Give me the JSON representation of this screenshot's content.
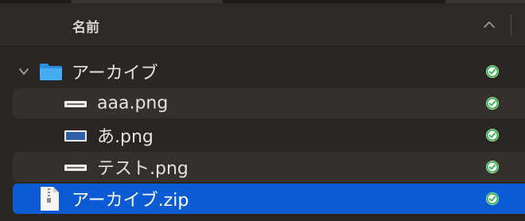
{
  "header": {
    "name_column_label": "名前"
  },
  "rows": [
    {
      "label": "アーカイブ",
      "type": "folder",
      "expanded": true,
      "sync_status": "synced"
    },
    {
      "label": "aaa.png",
      "type": "png",
      "sync_status": "synced"
    },
    {
      "label": "あ.png",
      "type": "png",
      "sync_status": "synced"
    },
    {
      "label": "テスト.png",
      "type": "png",
      "sync_status": "synced"
    },
    {
      "label": "アーカイブ.zip",
      "type": "zip",
      "selected": true,
      "sync_status": "synced"
    }
  ],
  "icons": {
    "sort": "chevron-up-icon",
    "disclosure": "chevron-down-icon",
    "folder": "folder-icon",
    "png": "image-file-icon",
    "zip": "zip-archive-icon",
    "status": "synced-check-icon"
  },
  "colors": {
    "selection": "#0a5bd4",
    "folder": "#3fa9f5",
    "status_green": "#2fb34a"
  }
}
